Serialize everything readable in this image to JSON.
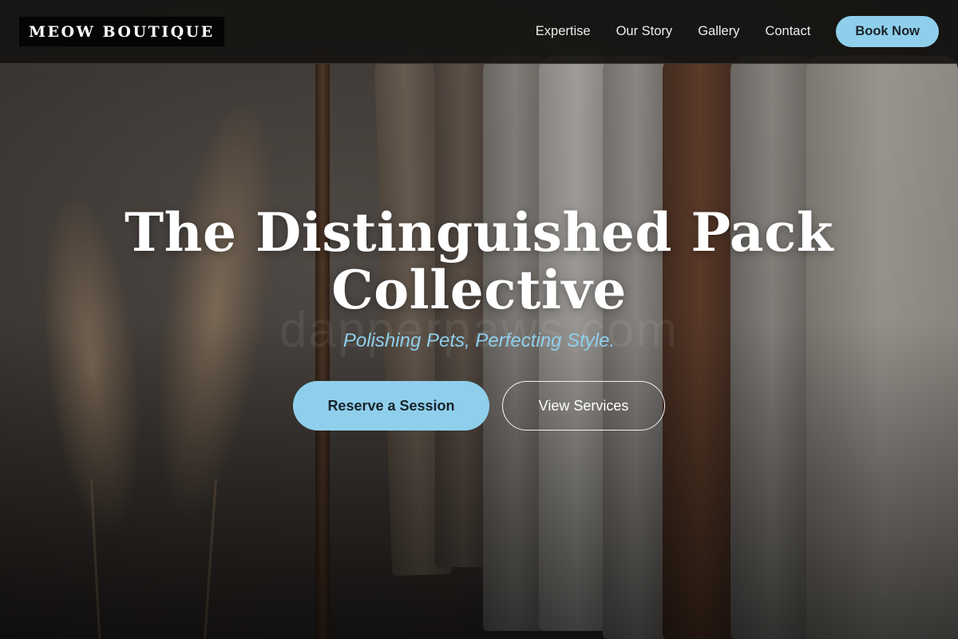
{
  "brand": {
    "logo_text": "MEOW BOUTIQUE"
  },
  "nav": {
    "links": [
      {
        "label": "Expertise"
      },
      {
        "label": "Our Story"
      },
      {
        "label": "Gallery"
      },
      {
        "label": "Contact"
      }
    ],
    "cta_label": "Book Now"
  },
  "hero": {
    "title_line1": "The Distinguished Pack",
    "title_line2": "Collective",
    "subtitle": "Polishing Pets, Perfecting Style.",
    "watermark": "dapperpaws.com",
    "primary_cta": "Reserve a Session",
    "secondary_cta": "View Services",
    "background_image": "clothing-rack-photo"
  },
  "colors": {
    "accent": "#8fcfec",
    "nav_background": "#161412",
    "logo_background": "#050505",
    "text_light": "#ffffff"
  }
}
